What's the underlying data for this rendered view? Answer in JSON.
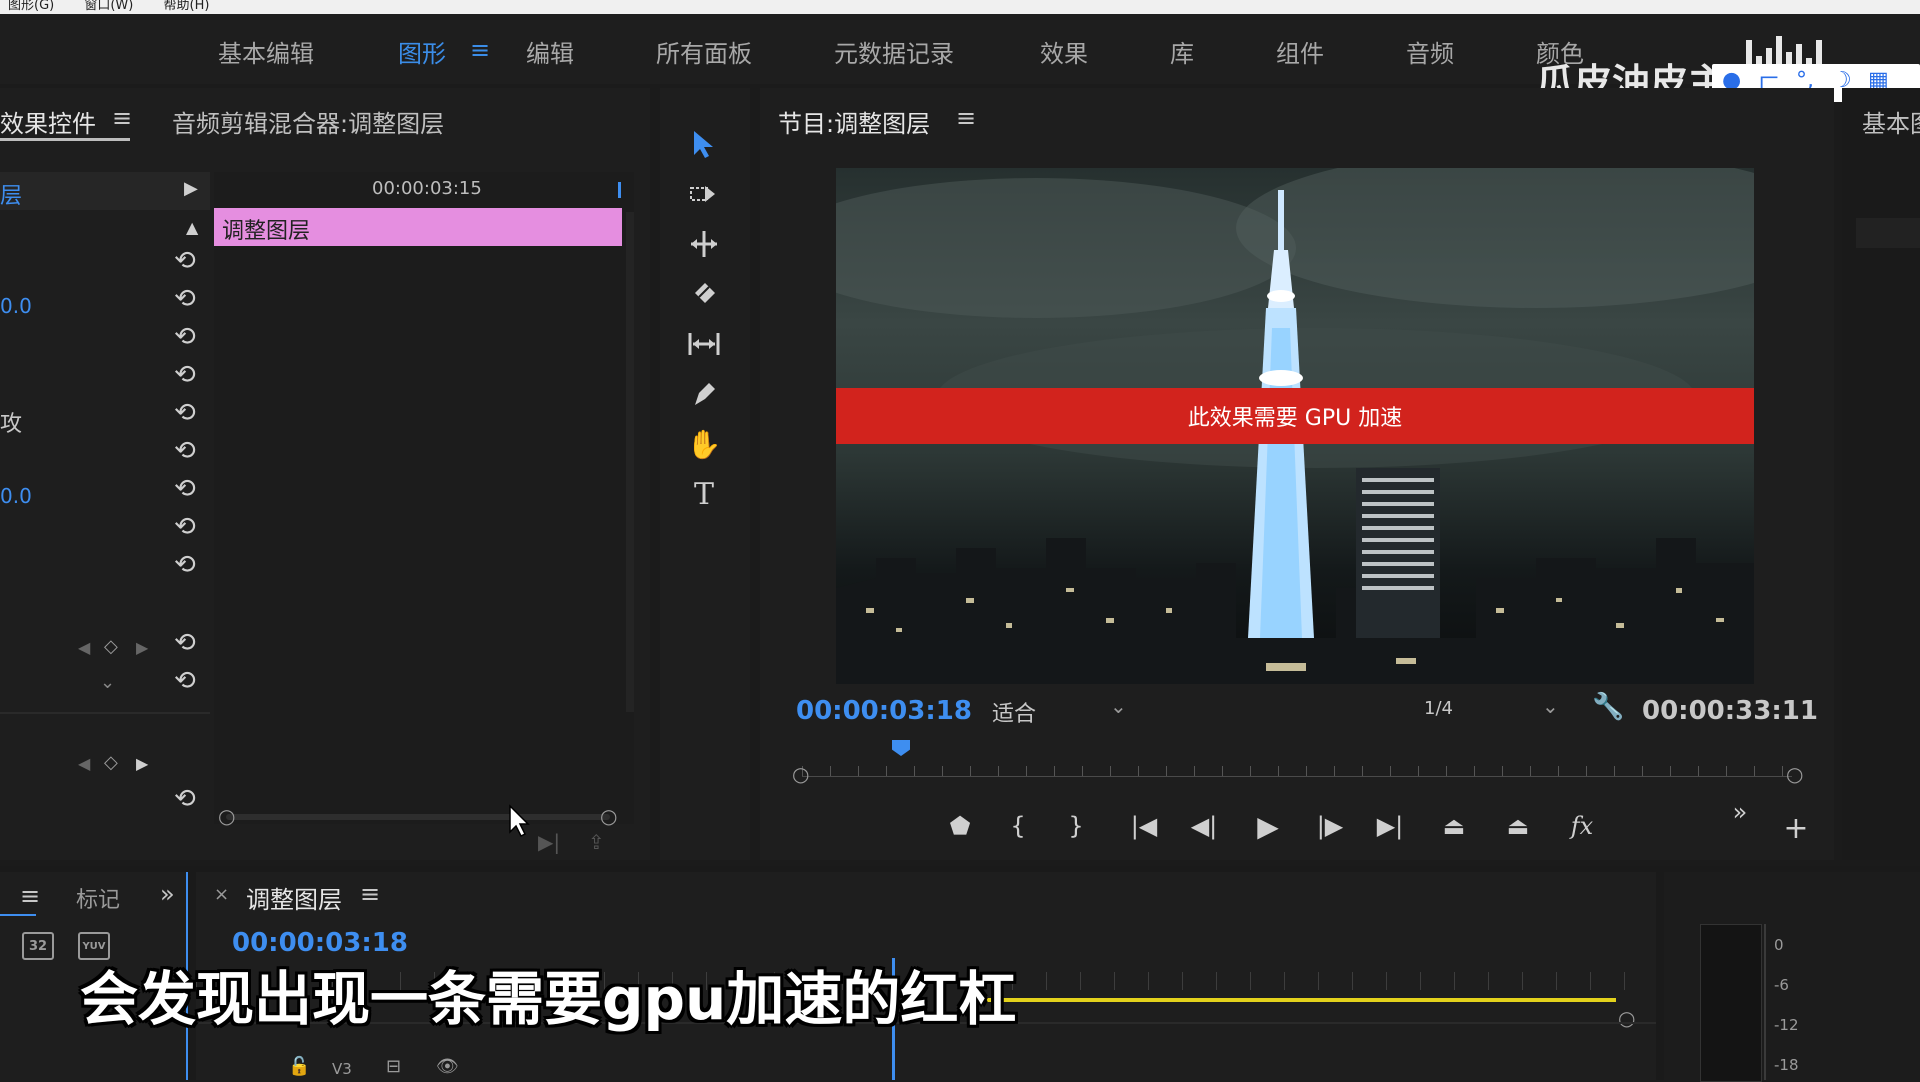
{
  "top_menu": {
    "items": [
      "图形(G)",
      "窗口(W)",
      "帮助(H)"
    ]
  },
  "workspaces": {
    "tabs": [
      "基本编辑",
      "图形",
      "编辑",
      "所有面板",
      "元数据记录",
      "效果",
      "库",
      "组件",
      "音频",
      "颜色"
    ],
    "active": "图形",
    "overflow_label": "基本图"
  },
  "watermark": {
    "text": "瓜皮油皮主"
  },
  "effect_controls": {
    "tab_label": "效果控件",
    "mixer_tab_label": "音频剪辑混合器:调整图层",
    "source_fragment": "层",
    "timecode": "00:00:03:15",
    "clip_label": "调整图层",
    "value_a": "0.0",
    "value_b": "0.0",
    "label_fragment": "攻"
  },
  "tools": [
    "selection-tool",
    "track-select-tool",
    "ripple-edit-tool",
    "razor-tool",
    "slip-tool",
    "pen-tool",
    "hand-tool",
    "type-tool"
  ],
  "program_monitor": {
    "title": "节目:调整图层",
    "gpu_warning": "此效果需要 GPU 加速",
    "current_timecode": "00:00:03:18",
    "fit_option": "适合",
    "resolution": "1/4",
    "duration": "00:00:33:11",
    "playhead_fraction": 0.1
  },
  "project_panel": {
    "tab_label": "标记"
  },
  "timeline": {
    "sequence_name": "调整图层",
    "timecode": "00:00:03:18",
    "track_label": "V3"
  },
  "meter": {
    "ticks": [
      "0",
      "-6",
      "-12",
      "-18"
    ]
  },
  "subtitle": {
    "text": "会发现出现一条需要gpu加速的红杠"
  },
  "colors": {
    "accent_blue": "#3e8ef0",
    "clip_pink": "#e58ee0",
    "warning_red": "#d2231d",
    "workarea_yellow": "#e3d21c"
  }
}
